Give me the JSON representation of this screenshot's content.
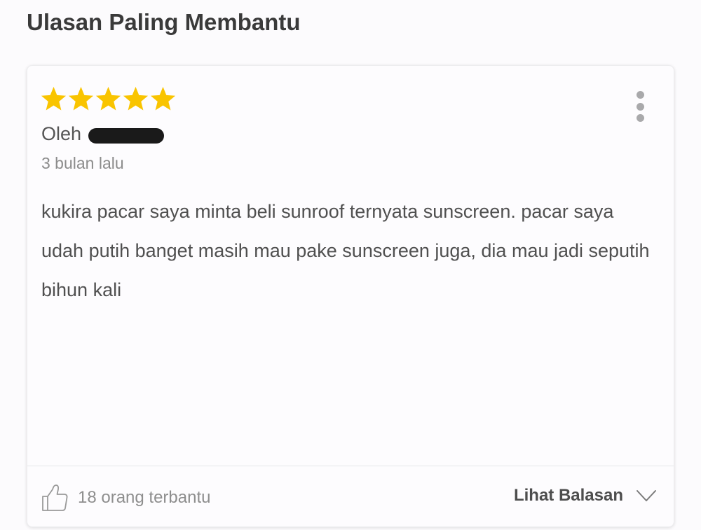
{
  "section": {
    "title": "Ulasan Paling Membantu"
  },
  "review": {
    "rating": 5,
    "rating_max": 5,
    "star_color": "#f9c400",
    "author_prefix": "Oleh",
    "time": "3 bulan lalu",
    "text": "kukira pacar saya minta beli sunroof ternyata sunscreen. pacar saya udah putih banget masih mau pake sunscreen juga, dia mau jadi seputih bihun kali",
    "helpful_count_text": "18 orang terbantu",
    "replies_label": "Lihat Balasan",
    "icons": {
      "menu": "more-vertical-icon",
      "helpful": "thumbs-up-icon",
      "replies": "chevron-down-icon"
    }
  }
}
